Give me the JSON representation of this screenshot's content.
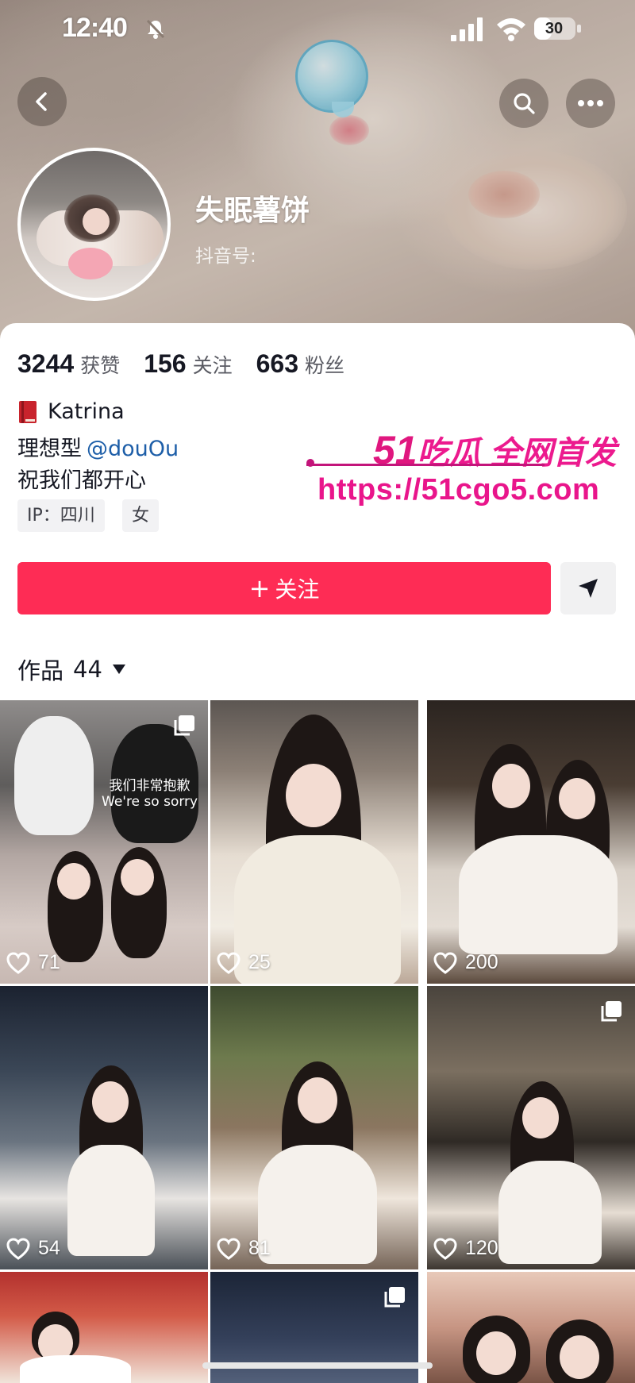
{
  "status_bar": {
    "time": "12:40",
    "battery": "30"
  },
  "profile": {
    "name": "失眠薯饼",
    "douyin_id_label": "抖音号:"
  },
  "stats": [
    {
      "value": "3244",
      "label": "获赞"
    },
    {
      "value": "156",
      "label": "关注"
    },
    {
      "value": "663",
      "label": "粉丝"
    }
  ],
  "bio": {
    "line1": "Katrina",
    "line2_prefix": "理想型",
    "line2_mention": "@douOu",
    "line3": "祝我们都开心"
  },
  "tags": {
    "ip": "IP：四川",
    "gender": "女"
  },
  "watermark": {
    "num": "51",
    "text": "吃瓜 全网首发",
    "url": "https://51cgo5.com"
  },
  "actions": {
    "follow_plus": "+",
    "follow_label": "关注"
  },
  "works": {
    "label": "作品",
    "count": "44"
  },
  "tile_caption": {
    "line1": "我们非常抱歉",
    "line2": "We're so sorry"
  },
  "grid": [
    {
      "likes": "71"
    },
    {
      "likes": "25"
    },
    {
      "likes": "200"
    },
    {
      "likes": "54"
    },
    {
      "likes": "81"
    },
    {
      "likes": "120"
    }
  ],
  "colors": {
    "follow_button": "#fe2c55",
    "mention": "#1d5ea8",
    "watermark": "#ec1a8e"
  }
}
